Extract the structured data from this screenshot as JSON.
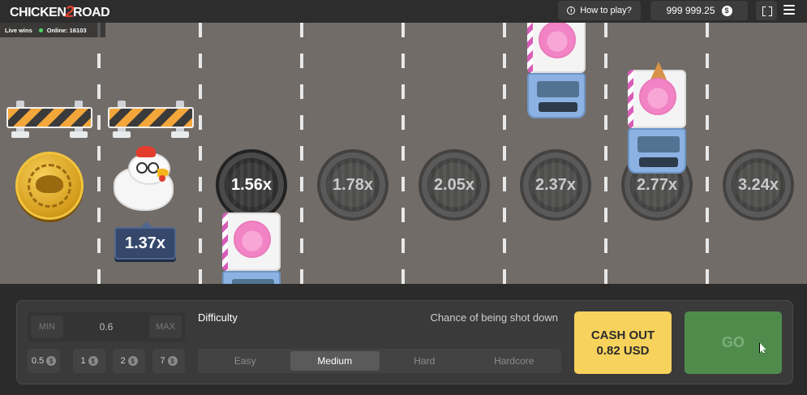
{
  "header": {
    "logo_left": "CHICKEN",
    "logo_num": "2",
    "logo_right": "ROAD",
    "how_to_play": "How to play?",
    "balance": "999 999.25",
    "currency_symbol": "$"
  },
  "live": {
    "label": "Live wins",
    "online": "Online: 16103"
  },
  "game": {
    "current_multiplier": "1.37x",
    "multipliers": [
      "1.56x",
      "1.78x",
      "2.05x",
      "2.37x",
      "2.77x",
      "3.24x"
    ]
  },
  "controls": {
    "bet_min": "MIN",
    "bet_value": "0.6",
    "bet_max": "MAX",
    "quick_bets": [
      "0.5",
      "1",
      "2",
      "7"
    ],
    "difficulty_label": "Difficulty",
    "chance_label": "Chance of being shot down",
    "difficulties": [
      "Easy",
      "Medium",
      "Hard",
      "Hardcore"
    ],
    "selected_difficulty": "Medium",
    "cashout_line1": "CASH OUT",
    "cashout_line2": "0.82 USD",
    "go_label": "GO"
  },
  "colors": {
    "road": "#716c68",
    "cashout": "#f7d25c",
    "go": "#4f8c4c",
    "multiplier_tag": "#35486b"
  }
}
